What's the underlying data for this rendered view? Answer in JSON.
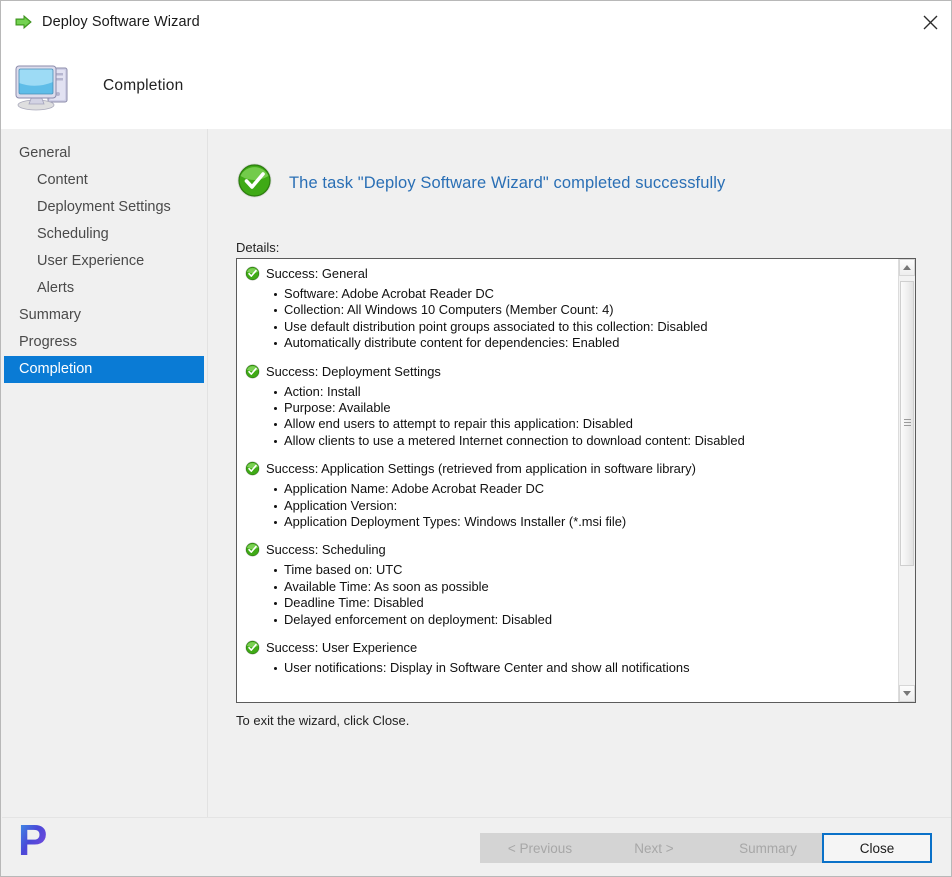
{
  "window": {
    "title": "Deploy Software Wizard",
    "title_icon": "green-arrow-icon",
    "close_icon": "close-icon"
  },
  "header": {
    "title": "Completion",
    "icon": "computer-icon"
  },
  "sidebar": {
    "items": [
      {
        "label": "General",
        "level": 0,
        "selected": false
      },
      {
        "label": "Content",
        "level": 1,
        "selected": false
      },
      {
        "label": "Deployment Settings",
        "level": 1,
        "selected": false
      },
      {
        "label": "Scheduling",
        "level": 1,
        "selected": false
      },
      {
        "label": "User Experience",
        "level": 1,
        "selected": false
      },
      {
        "label": "Alerts",
        "level": 1,
        "selected": false
      },
      {
        "label": "Summary",
        "level": 0,
        "selected": false
      },
      {
        "label": "Progress",
        "level": 0,
        "selected": false
      },
      {
        "label": "Completion",
        "level": 0,
        "selected": true
      }
    ],
    "selected_bg": "#0a7bd5"
  },
  "content": {
    "banner_text": "The task \"Deploy Software Wizard\" completed successfully",
    "banner_icon": "success-check-icon",
    "banner_color": "#2a6fb5",
    "details_label": "Details:",
    "exit_note": "To exit the wizard, click Close.",
    "detail_groups": [
      {
        "status_icon": "success-check-icon",
        "heading": "Success: General",
        "bullets": [
          "Software: Adobe Acrobat Reader DC",
          "Collection: All Windows 10 Computers (Member Count: 4)",
          "Use default distribution point groups associated to this collection: Disabled",
          "Automatically distribute content for dependencies: Enabled"
        ]
      },
      {
        "status_icon": "success-check-icon",
        "heading": "Success: Deployment Settings",
        "bullets": [
          "Action: Install",
          "Purpose: Available",
          "Allow end users to attempt to repair this application: Disabled",
          "Allow clients to use a metered Internet connection to download content: Disabled"
        ]
      },
      {
        "status_icon": "success-check-icon",
        "heading": "Success: Application Settings (retrieved from application in software library)",
        "bullets": [
          "Application Name: Adobe Acrobat Reader DC",
          "Application Version:",
          "Application Deployment Types: Windows Installer (*.msi file)"
        ]
      },
      {
        "status_icon": "success-check-icon",
        "heading": "Success: Scheduling",
        "bullets": [
          "Time based on: UTC",
          "Available Time: As soon as possible",
          "Deadline Time: Disabled",
          "Delayed enforcement on deployment: Disabled"
        ]
      },
      {
        "status_icon": "success-check-icon",
        "heading": "Success: User Experience",
        "bullets": [
          "User notifications: Display in Software Center and show all notifications"
        ]
      }
    ],
    "scrollbar": {
      "up_icon": "scroll-up-arrow-icon",
      "down_icon": "scroll-down-arrow-icon",
      "thumb": "scrollbar-thumb"
    }
  },
  "footer": {
    "buttons": [
      {
        "id": "previous",
        "label": "< Previous",
        "enabled": false
      },
      {
        "id": "next",
        "label": "Next >",
        "enabled": false
      },
      {
        "id": "summary",
        "label": "Summary",
        "enabled": false
      },
      {
        "id": "close",
        "label": "Close",
        "enabled": true
      }
    ],
    "focus_color": "#0a71c8"
  },
  "branding": {
    "logo_letter": "P"
  }
}
